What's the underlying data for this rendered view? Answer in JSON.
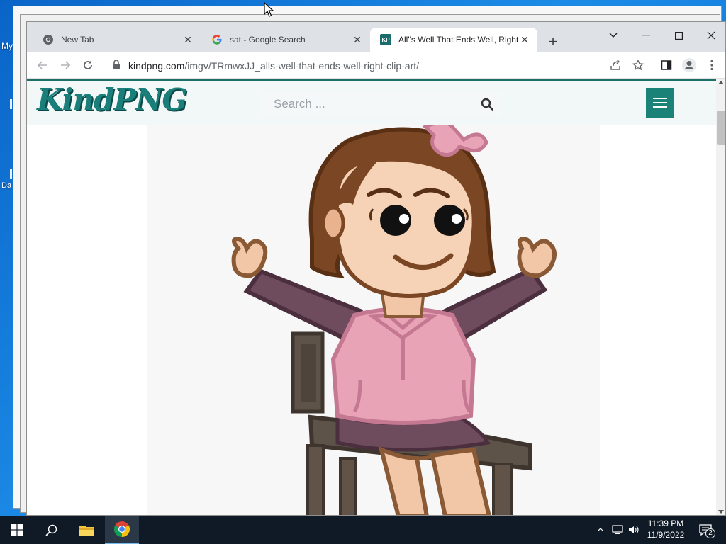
{
  "desktop": {
    "label_1": "My",
    "label_2": "Da"
  },
  "browser": {
    "tabs": [
      {
        "title": "New Tab",
        "icon": "chrome-icon"
      },
      {
        "title": "sat - Google Search",
        "icon": "google-icon"
      },
      {
        "title": "All''s Well That Ends Well, Right",
        "icon": "kindpng-favicon",
        "favicon_text": "KP",
        "active": true
      }
    ],
    "address": {
      "domain": "kindpng.com",
      "path": "/imgv/TRmwxJJ_alls-well-that-ends-well-right-clip-art/"
    }
  },
  "site": {
    "logo": "KindPNG",
    "search_placeholder": "Search ...",
    "brand_color": "#1a8277"
  },
  "taskbar": {
    "time": "11:39 PM",
    "date": "11/9/2022",
    "notifications": "2"
  },
  "colors": {
    "desktop": "#1b8be6",
    "taskbar": "#101a26",
    "accent": "#1a7f7a"
  }
}
